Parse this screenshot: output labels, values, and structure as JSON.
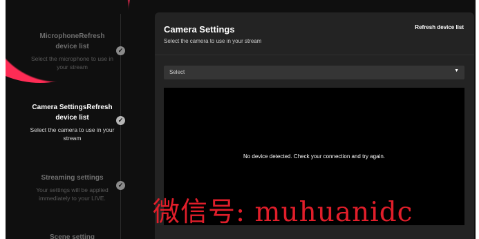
{
  "sidebar": {
    "steps": [
      {
        "title": "MicrophoneRefresh device list",
        "desc": "Select the microphone to use in your stream"
      },
      {
        "title": "Camera SettingsRefresh device list",
        "desc": "Select the camera to use in your stream"
      },
      {
        "title": "Streaming settings",
        "desc": "Your settings will be applied immediately to your LIVE."
      },
      {
        "title": "Scene setting",
        "desc": ""
      }
    ]
  },
  "main": {
    "title": "Camera Settings",
    "subtitle": "Select the camera to use in your stream",
    "refresh_label": "Refresh device list",
    "select_value": "Select",
    "empty_message": "No device detected. Check your connection and try again."
  },
  "watermark": "微信号: muhuanidc",
  "icons": {
    "check": "checkmark-icon",
    "caret": "caret-down-icon"
  },
  "colors": {
    "background": "#0f0f0f",
    "card": "#232323",
    "accent": "#fe2c55"
  }
}
